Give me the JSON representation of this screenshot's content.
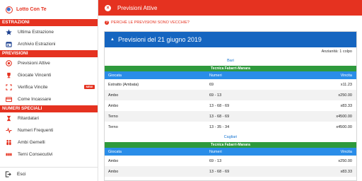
{
  "app": {
    "title": "Lotto Con Te"
  },
  "drawer": {
    "sections": [
      {
        "title": "ESTRAZIONI",
        "items": [
          {
            "label": "Ultima Estrazione",
            "icon": "star-icon"
          },
          {
            "label": "Archivio Estrazioni",
            "icon": "calendar-icon"
          }
        ]
      },
      {
        "title": "PREVISIONI",
        "items": [
          {
            "label": "Previsioni Attive",
            "icon": "target-icon"
          },
          {
            "label": "Giocate Vincenti",
            "icon": "trophy-icon"
          },
          {
            "label": "Verifica Vincite",
            "icon": "scan-icon",
            "badge": "NEW"
          },
          {
            "label": "Come Incassare",
            "icon": "card-icon"
          }
        ]
      },
      {
        "title": "NUMERI SPECIALI",
        "items": [
          {
            "label": "Ritardatari",
            "icon": "hourglass-icon"
          },
          {
            "label": "Numeri Frequenti",
            "icon": "pulse-icon"
          },
          {
            "label": "Ambi Gemelli",
            "icon": "people-icon"
          },
          {
            "label": "Terni Consecutivi",
            "icon": "sequence-icon"
          }
        ]
      }
    ],
    "footer": {
      "label": "Esci"
    }
  },
  "main": {
    "title": "Previsioni Attive",
    "why_link": "PERCHÈ LE PREVISIONI SONO VECCHIE?",
    "card": {
      "title": "Previsioni del 21 giugno 2019",
      "age": "Anzianità: 1 colpo",
      "columns": [
        "Giocata",
        "Numeri",
        "Vincita"
      ],
      "groups": [
        {
          "city": "Bari",
          "technique": "Tecnica Fabarri-Manara",
          "rows": [
            [
              "Estratto (Ambata)",
              "69",
              "x11.23"
            ],
            [
              "Ambo",
              "69 - 13",
              "x250.00"
            ],
            [
              "Ambo",
              "13 - 68 - 69",
              "x83.33"
            ],
            [
              "Terno",
              "13 - 68 - 69",
              "x4500.00"
            ],
            [
              "Terno",
              "13 - 35 - 34",
              "x4500.00"
            ]
          ]
        },
        {
          "city": "Cagliari",
          "technique": "Tecnica Fabarri-Manara",
          "rows": [
            [
              "Ambo",
              "69 - 13",
              "x250.00"
            ],
            [
              "Ambo",
              "13 - 68 - 69",
              "x83.33"
            ]
          ]
        }
      ]
    }
  },
  "colors": {
    "accent": "#e53220",
    "header_blue": "#1565c0",
    "table_blue": "#2a8de8",
    "technique_green": "#2e9a3c"
  }
}
